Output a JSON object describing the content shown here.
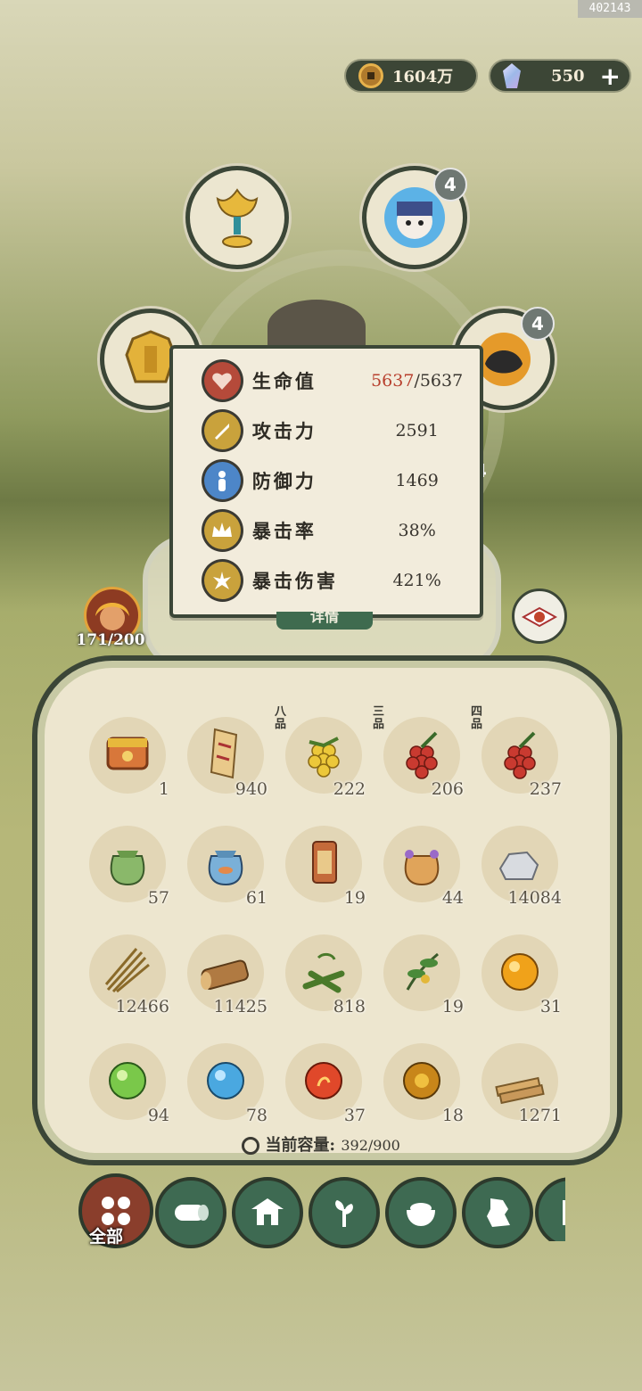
{
  "build_tag": "402143",
  "currency": {
    "coins": "1604万",
    "gems": "550",
    "add": "+"
  },
  "slots": {
    "spirit_level": "4",
    "pet_level": "4",
    "side_level": "4"
  },
  "stats": [
    {
      "label": "生命值",
      "current": "5637",
      "max": "/5637",
      "icon": "heart-icon",
      "color": "#b54a3a"
    },
    {
      "label": "攻击力",
      "value": "2591",
      "icon": "sword-icon",
      "color": "#c9a23c"
    },
    {
      "label": "防御力",
      "value": "1469",
      "icon": "person-icon",
      "color": "#4d86c8"
    },
    {
      "label": "暴击率",
      "value": "38%",
      "icon": "crown-icon",
      "color": "#c9a23c"
    },
    {
      "label": "暴击伤害",
      "value": "421%",
      "icon": "burst-icon",
      "color": "#c9a23c"
    }
  ],
  "stamina": "171/200",
  "detail_button": "详情",
  "inventory": [
    {
      "name": "treasure-chest",
      "count": "1"
    },
    {
      "name": "scroll",
      "count": "940"
    },
    {
      "name": "golden-berries",
      "count": "222",
      "grade": "八品"
    },
    {
      "name": "red-berries",
      "count": "206",
      "grade": "三品"
    },
    {
      "name": "red-berries",
      "count": "237",
      "grade": "四品"
    },
    {
      "name": "green-pouch",
      "count": "57"
    },
    {
      "name": "blue-fish-pouch",
      "count": "61"
    },
    {
      "name": "talisman-tag",
      "count": "19"
    },
    {
      "name": "orange-pouch",
      "count": "44"
    },
    {
      "name": "stone",
      "count": "14084"
    },
    {
      "name": "straw",
      "count": "12466"
    },
    {
      "name": "wood-log",
      "count": "11425"
    },
    {
      "name": "bamboo",
      "count": "818"
    },
    {
      "name": "herb",
      "count": "19"
    },
    {
      "name": "gold-orb",
      "count": "31"
    },
    {
      "name": "green-orb",
      "count": "94"
    },
    {
      "name": "blue-orb",
      "count": "78"
    },
    {
      "name": "red-orb",
      "count": "37"
    },
    {
      "name": "amber-orb",
      "count": "18"
    },
    {
      "name": "wood-planks",
      "count": "1271"
    }
  ],
  "capacity": {
    "label": "当前容量:",
    "value": "392/900"
  },
  "tabs": {
    "all": "全部"
  }
}
